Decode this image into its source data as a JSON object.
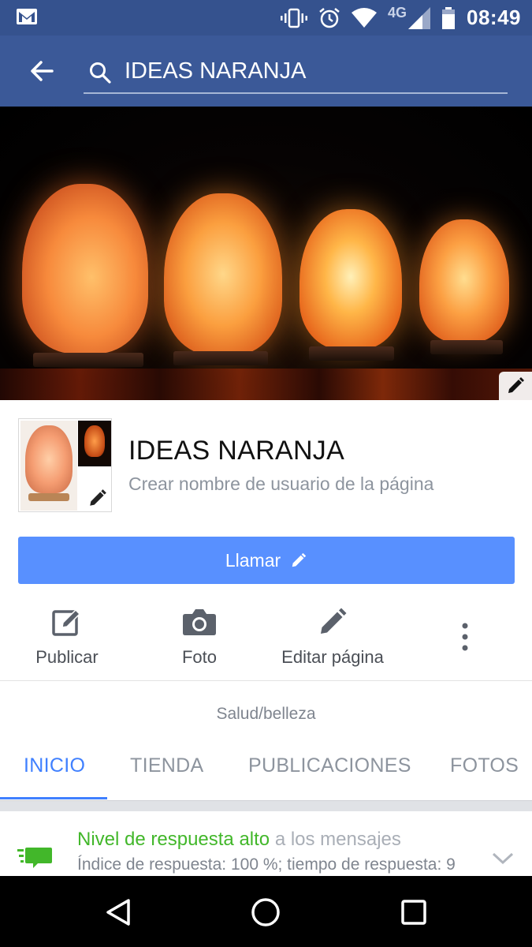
{
  "status_bar": {
    "time": "08:49",
    "network": "4G",
    "icons": [
      "gmail-icon",
      "vibrate-icon",
      "alarm-icon",
      "wifi-icon",
      "cell-signal-icon",
      "battery-icon"
    ]
  },
  "header": {
    "search_query": "IDEAS NARANJA",
    "icons": [
      "back-arrow-icon",
      "search-icon"
    ]
  },
  "page": {
    "name": "IDEAS NARANJA",
    "username_prompt": "Crear nombre de usuario de la página",
    "category": "Salud/belleza"
  },
  "call_button": {
    "label": "Llamar"
  },
  "actions": [
    {
      "label": "Publicar",
      "icon": "compose-icon"
    },
    {
      "label": "Foto",
      "icon": "camera-icon"
    },
    {
      "label": "Editar página",
      "icon": "pencil-icon"
    },
    {
      "label": "",
      "icon": "more-vertical-icon"
    }
  ],
  "tabs": [
    {
      "label": "INICIO",
      "active": true
    },
    {
      "label": "TIENDA",
      "active": false
    },
    {
      "label": "PUBLICACIONES",
      "active": false
    },
    {
      "label": "FOTOS",
      "active": false
    }
  ],
  "response_card": {
    "title_highlight": "Nivel de respuesta alto",
    "title_rest": "a los mensajes",
    "subtitle": "Índice de respuesta: 100 %; tiempo de respuesta: 9"
  },
  "colors": {
    "status_bar": "#35528e",
    "header": "#3b5998",
    "accent_blue": "#4080ff",
    "call_button": "#5890ff",
    "green": "#42b72a"
  }
}
